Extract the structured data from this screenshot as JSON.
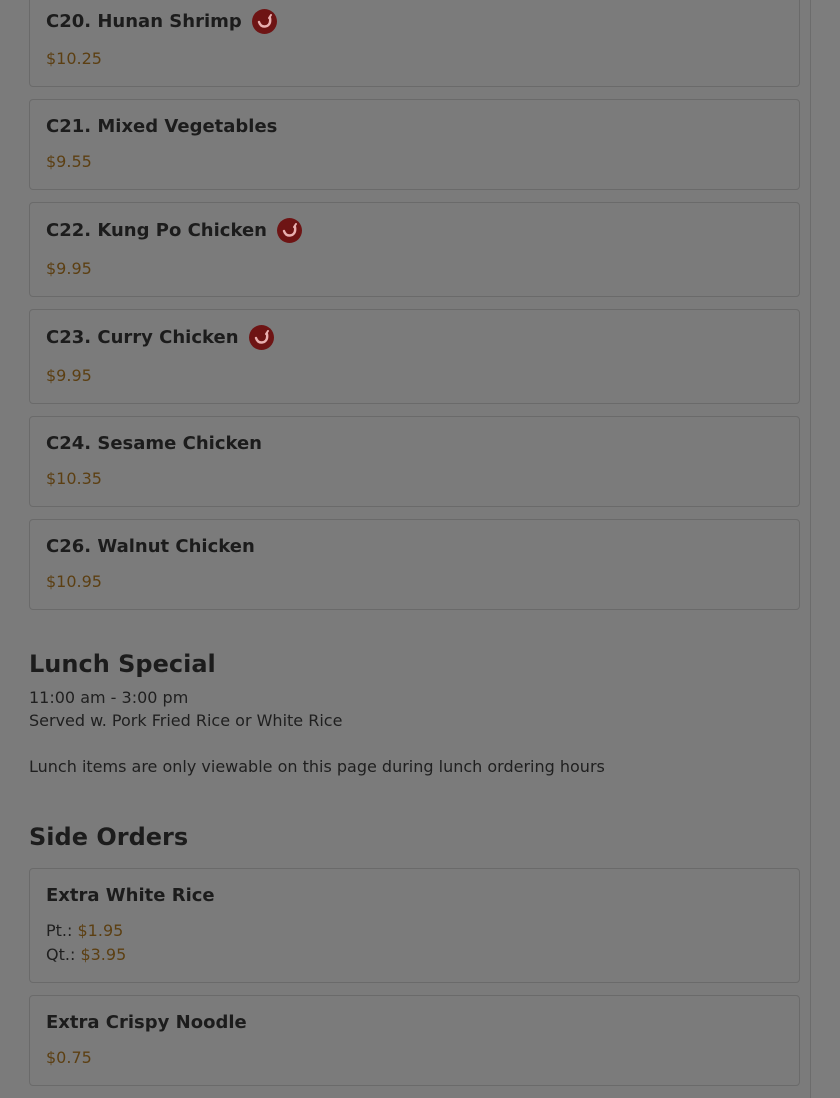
{
  "items_top": [
    {
      "title": "C20. Hunan Shrimp",
      "price": "$10.25",
      "spicy": true
    },
    {
      "title": "C21. Mixed Vegetables",
      "price": "$9.55",
      "spicy": false
    },
    {
      "title": "C22. Kung Po Chicken",
      "price": "$9.95",
      "spicy": true
    },
    {
      "title": "C23. Curry Chicken",
      "price": "$9.95",
      "spicy": true
    },
    {
      "title": "C24. Sesame Chicken",
      "price": "$10.35",
      "spicy": false
    },
    {
      "title": "C26. Walnut Chicken",
      "price": "$10.95",
      "spicy": false
    }
  ],
  "lunch": {
    "title": "Lunch Special",
    "hours": "11:00 am - 3:00 pm",
    "served": "Served w. Pork Fried Rice or White Rice",
    "note": "Lunch items are only viewable on this page during lunch ordering hours"
  },
  "side_orders": {
    "title": "Side Orders",
    "items": [
      {
        "title": "Extra White Rice",
        "pt_label": "Pt.:",
        "pt_price": "$1.95",
        "qt_label": "Qt.:",
        "qt_price": "$3.95"
      },
      {
        "title": "Extra Crispy Noodle",
        "price": "$0.75"
      }
    ]
  },
  "colors": {
    "overlay_bg": "#7b7b7b",
    "price": "#5c3f12",
    "spicy_badge": "#6e1414"
  }
}
